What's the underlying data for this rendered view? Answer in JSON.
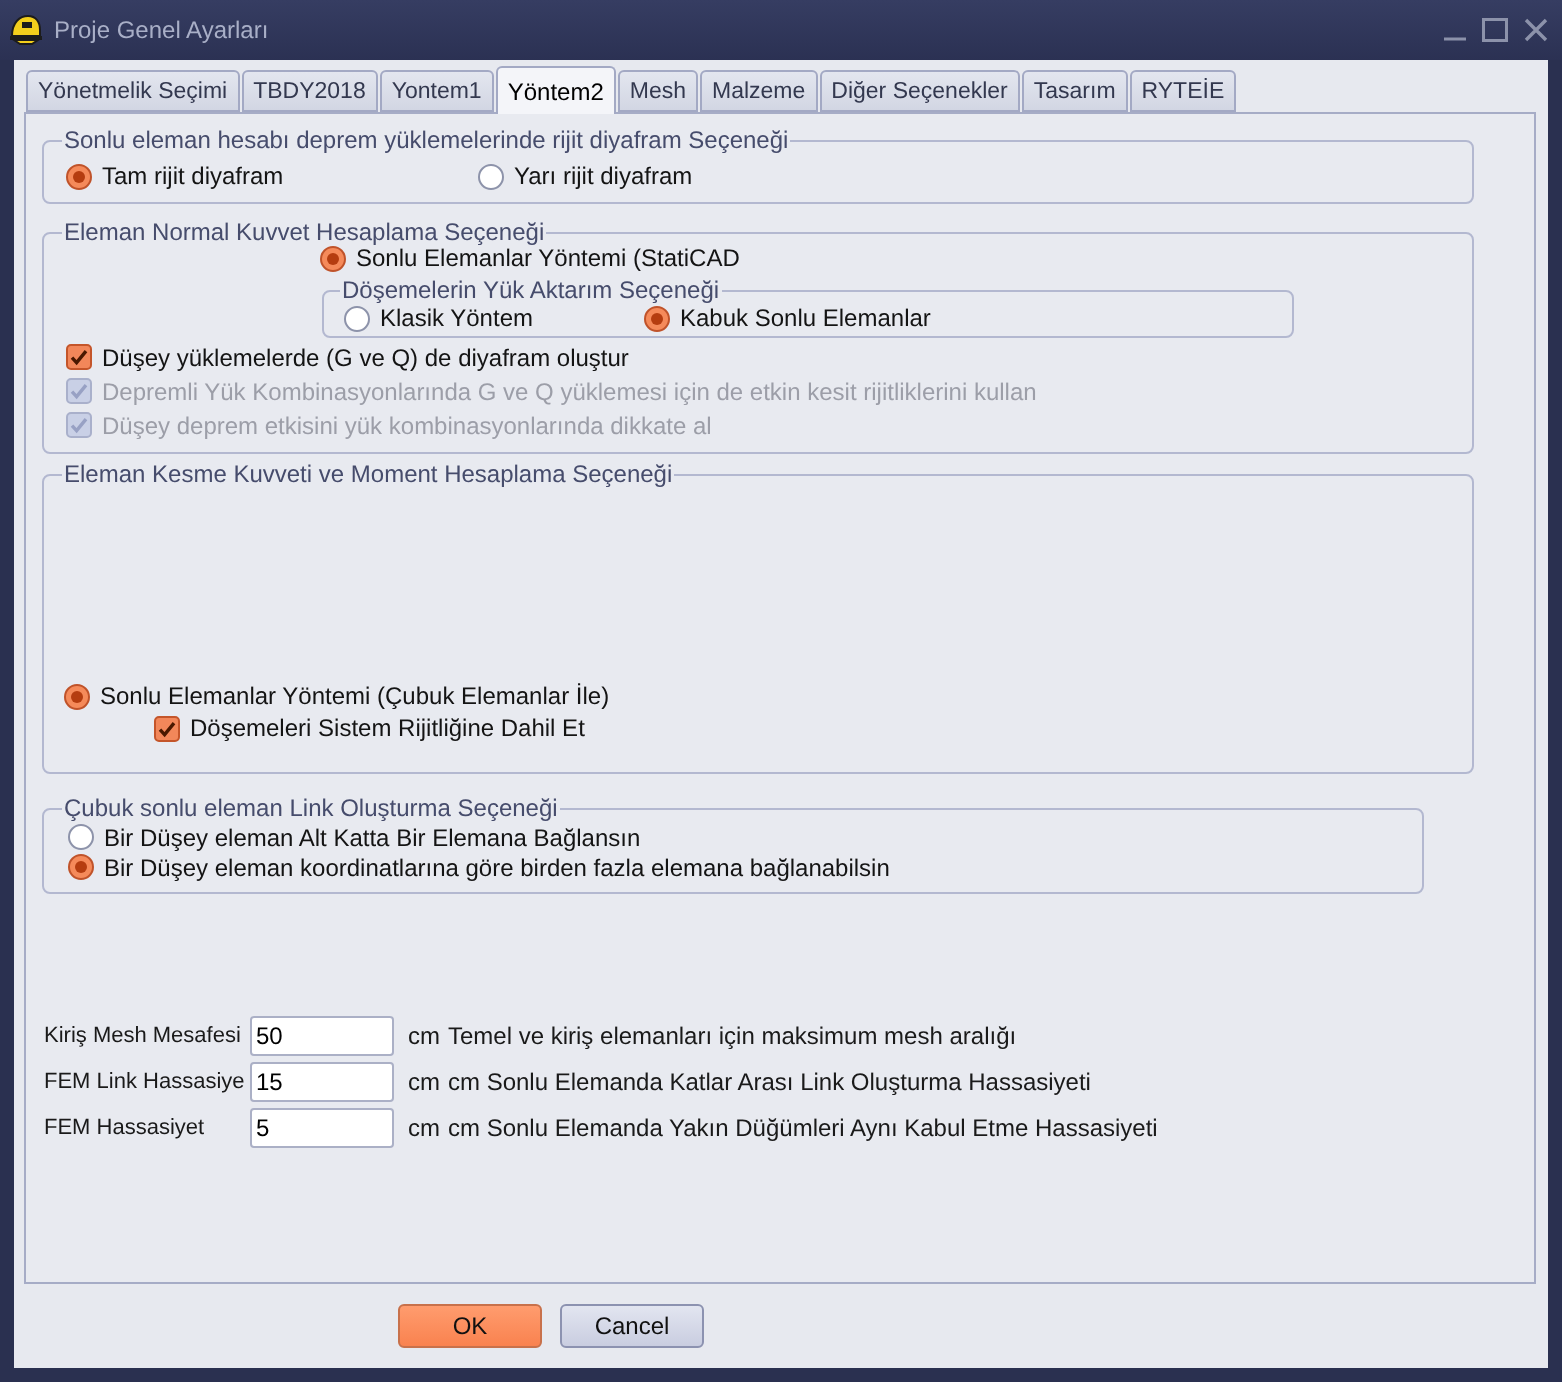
{
  "window": {
    "title": "Proje Genel Ayarları"
  },
  "tabs": [
    {
      "label": "Yönetmelik Seçimi",
      "selected": false
    },
    {
      "label": "TBDY2018",
      "selected": false
    },
    {
      "label": "Yontem1",
      "selected": false
    },
    {
      "label": "Yöntem2",
      "selected": true
    },
    {
      "label": "Mesh",
      "selected": false
    },
    {
      "label": "Malzeme",
      "selected": false
    },
    {
      "label": "Diğer Seçenekler",
      "selected": false
    },
    {
      "label": "Tasarım",
      "selected": false
    },
    {
      "label": "RYTEİE",
      "selected": false
    }
  ],
  "rigid_diaphragm_group": {
    "legend": "Sonlu eleman hesabı deprem yüklemelerinde rijit diyafram Seçeneği",
    "options": [
      {
        "label": "Tam rijit diyafram",
        "selected": true
      },
      {
        "label": "Yarı rijit diyafram",
        "selected": false
      }
    ]
  },
  "normal_force_group": {
    "legend": "Eleman Normal Kuvvet Hesaplama Seçeneği",
    "method": {
      "label": "Sonlu Elemanlar Yöntemi (StatiCAD",
      "selected": true
    },
    "slab_load_transfer": {
      "legend": "Döşemelerin Yük Aktarım Seçeneği",
      "options": [
        {
          "label": "Klasik Yöntem",
          "selected": false
        },
        {
          "label": "Kabuk Sonlu Elemanlar",
          "selected": true
        }
      ]
    },
    "checkboxes": [
      {
        "label": "Düşey yüklemelerde (G ve Q) de diyafram oluştur",
        "checked": true,
        "disabled": false
      },
      {
        "label": "Depremli Yük Kombinasyonlarında G ve Q yüklemesi için de etkin kesit rijitliklerini kullan",
        "checked": true,
        "disabled": true
      },
      {
        "label": "Düşey deprem etkisini yük kombinasyonlarında dikkate al",
        "checked": true,
        "disabled": true
      }
    ]
  },
  "shear_moment_group": {
    "legend": "Eleman Kesme Kuvveti ve Moment Hesaplama Seçeneği",
    "method": {
      "label": "Sonlu Elemanlar Yöntemi (Çubuk Elemanlar İle)",
      "selected": true
    },
    "checkbox": {
      "label": "Döşemeleri Sistem Rijitliğine Dahil Et",
      "checked": true
    }
  },
  "link_group": {
    "legend": "Çubuk sonlu eleman Link Oluşturma Seçeneği",
    "options": [
      {
        "label": "Bir Düşey eleman Alt Katta Bir Elemana Bağlansın",
        "selected": false
      },
      {
        "label": "Bir Düşey eleman koordinatlarına göre birden fazla elemana bağlanabilsin",
        "selected": true
      }
    ]
  },
  "fields": [
    {
      "label": "Kiriş Mesh Mesafesi",
      "value": "50",
      "unit": "cm",
      "note": "Temel ve kiriş elemanları için maksimum mesh aralığı"
    },
    {
      "label": "FEM Link Hassasiye",
      "value": "15",
      "unit": "cm",
      "note": "cm Sonlu Elemanda Katlar Arası Link Oluşturma Hassasiyeti"
    },
    {
      "label": "FEM Hassasiyet",
      "value": "5",
      "unit": "cm",
      "note": "cm Sonlu Elemanda Yakın Düğümleri Aynı Kabul Etme Hassasiyeti"
    }
  ],
  "buttons": [
    {
      "label": "OK",
      "kind": "primary"
    },
    {
      "label": "Cancel",
      "kind": "secondary"
    }
  ]
}
